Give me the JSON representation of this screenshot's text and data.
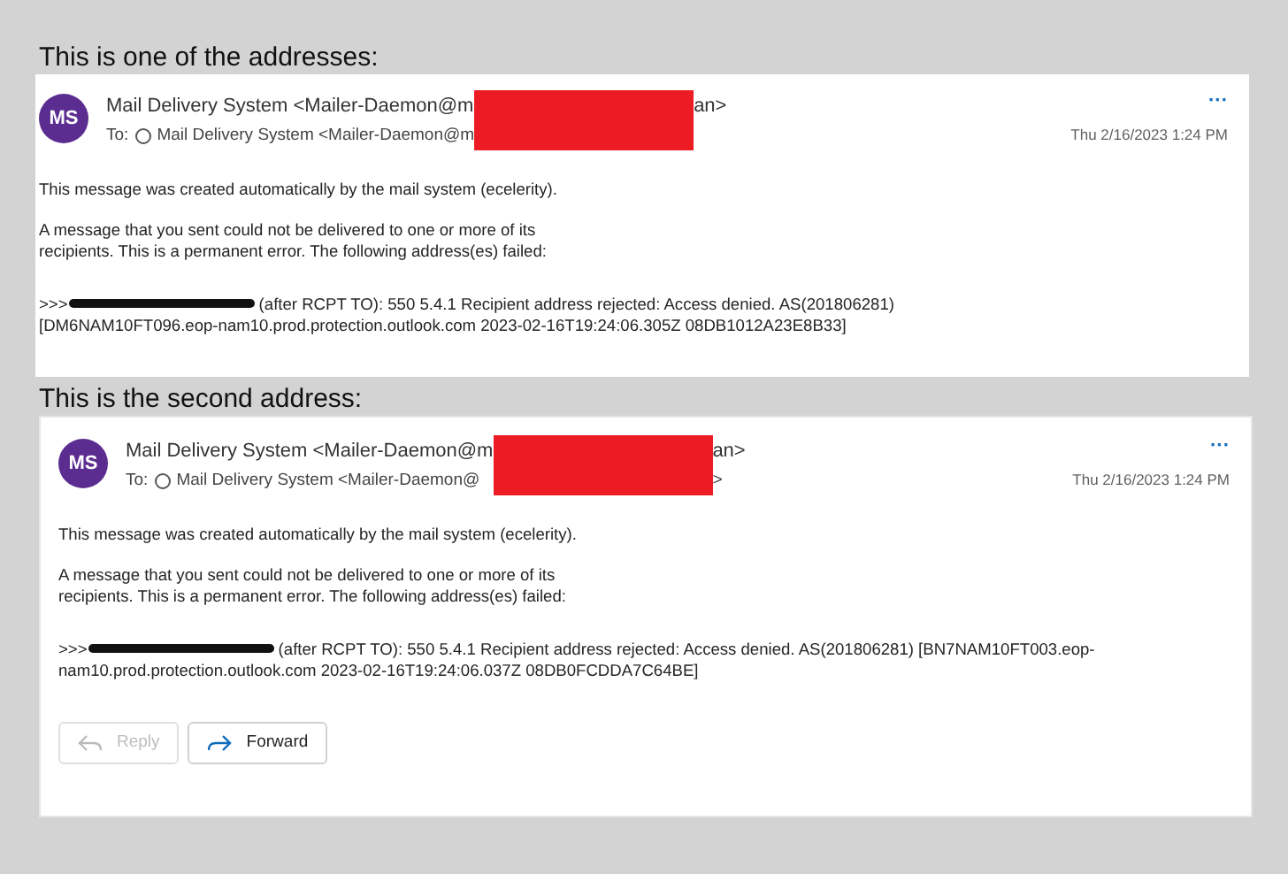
{
  "sections": [
    {
      "caption": "This is one of the addresses:",
      "message": {
        "initials": "MS",
        "sender": "Mail Delivery System <Mailer-Daemon@m",
        "sender_tail": "an>",
        "to_label": "To:",
        "to": "Mail Delivery System <Mailer-Daemon@m",
        "date": "Thu 2/16/2023 1:24 PM",
        "more": "···",
        "paragraphs": [
          [
            "This message was created automatically by the mail system (ecelerity)."
          ],
          [
            "A message that you sent could not be delivered to one or more of its",
            "recipients. This is a permanent error. The following address(es) failed:"
          ]
        ],
        "failure_prefix": ">>>",
        "failure_lines": [
          "(after RCPT TO): 550 5.4.1 Recipient address rejected: Access denied. AS(201806281)",
          "[DM6NAM10FT096.eop-nam10.prod.protection.outlook.com 2023-02-16T19:24:06.305Z 08DB1012A23E8B33]"
        ]
      }
    },
    {
      "caption": "This is the second address:",
      "message": {
        "initials": "MS",
        "sender": "Mail Delivery System <Mailer-Daemon@m",
        "sender_tail": "an>",
        "to_label": "To:",
        "to": "Mail Delivery System <Mailer-Daemon@",
        "to_tail": ">",
        "date": "Thu 2/16/2023 1:24 PM",
        "more": "···",
        "paragraphs": [
          [
            "This message was created automatically by the mail system (ecelerity)."
          ],
          [
            "A message that you sent could not be delivered to one or more of its",
            "recipients. This is a permanent error. The following address(es) failed:"
          ]
        ],
        "failure_prefix": ">>>",
        "failure_lines": [
          "(after RCPT TO): 550 5.4.1 Recipient address rejected: Access denied. AS(201806281) [BN7NAM10FT003.eop-",
          "nam10.prod.protection.outlook.com 2023-02-16T19:24:06.037Z 08DB0FCDDA7C64BE]"
        ],
        "actions": [
          {
            "kind": "reply",
            "label": "Reply",
            "disabled": true
          },
          {
            "kind": "forward",
            "label": "Forward",
            "disabled": false
          }
        ]
      }
    }
  ]
}
